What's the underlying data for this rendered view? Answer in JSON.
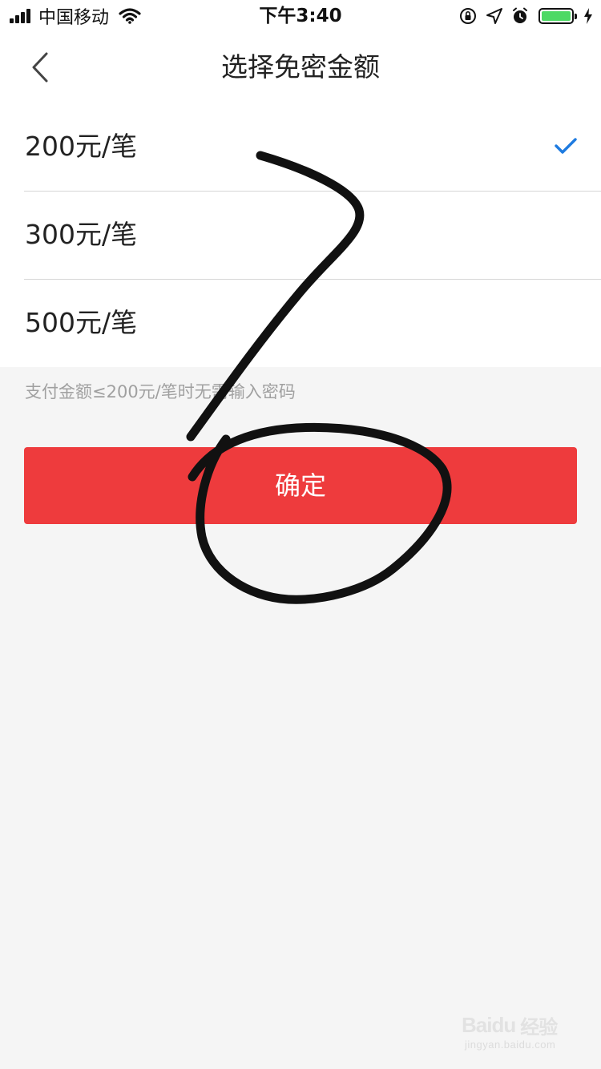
{
  "status_bar": {
    "carrier": "中国移动",
    "time": "下午3:40",
    "battery_level": 1.0
  },
  "nav": {
    "title": "选择免密金额",
    "back_icon": "chevron-left-icon"
  },
  "options": [
    {
      "label": "200元/笔",
      "selected": true
    },
    {
      "label": "300元/笔",
      "selected": false
    },
    {
      "label": "500元/笔",
      "selected": false
    }
  ],
  "hint": "支付金额≤200元/笔时无需输入密码",
  "confirm_label": "确定",
  "watermark": {
    "logo": "Baidu",
    "logo_cn": "经验",
    "url": "jingyan.baidu.com"
  },
  "colors": {
    "accent_blue": "#1e7be0",
    "confirm_red": "#ee3b3d",
    "battery_green": "#4cd964",
    "hint_gray": "#a0a0a0"
  }
}
